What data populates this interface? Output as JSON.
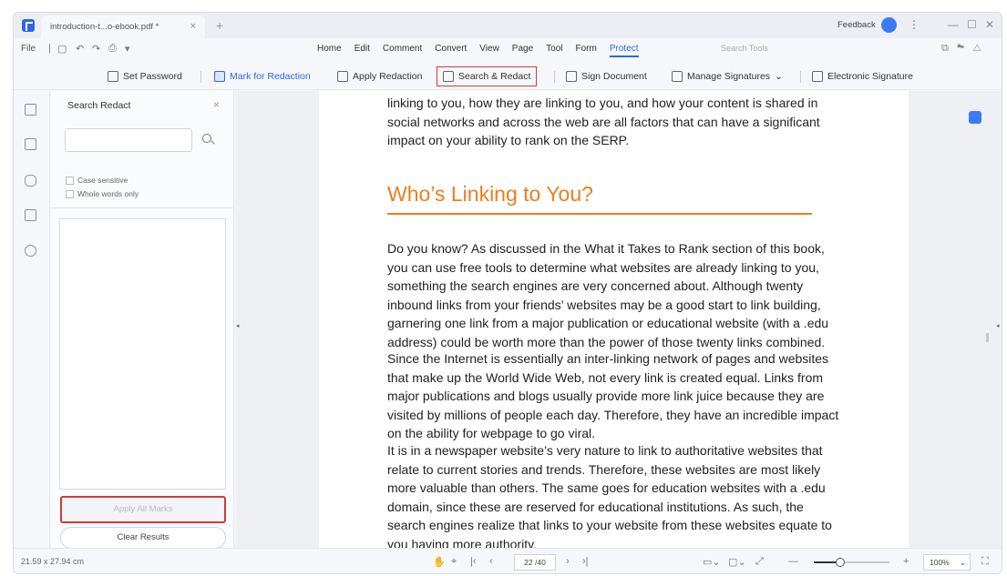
{
  "window": {
    "tab_title": "introduction-t...o-ebook.pdf *",
    "tab_close": "×",
    "tab_add": "+",
    "feedback": "Feedback",
    "avatar_letter": "",
    "kebab": "⋮",
    "btn_minimize": "—",
    "btn_maximize": "☐",
    "btn_close": "✕"
  },
  "menubar": {
    "file": "File",
    "tabs": [
      "Home",
      "Edit",
      "Comment",
      "Convert",
      "View",
      "Page",
      "Tool",
      "Form",
      "Protect"
    ],
    "active_tab": "Protect",
    "search_tools": "Search Tools"
  },
  "toolbar": {
    "set_password": "Set Password",
    "mark_for_redaction": "Mark for Redaction",
    "apply_redaction": "Apply Redaction",
    "search_redact": "Search & Redact",
    "sign_document": "Sign Document",
    "manage_signatures": "Manage Signatures",
    "electronic_signature": "Electronic Signature"
  },
  "panel": {
    "title": "Search  Redact",
    "close": "×",
    "search_value": "",
    "case_sensitive": "Case sensitive",
    "whole_words": "Whole words only",
    "apply_all_marks": "Apply All Marks",
    "clear_results": "Clear Results"
  },
  "document": {
    "para_top": "linking to you, how they are linking to you, and how your content is shared in social networks and across the web are all factors that can have a significant impact on your ability to rank on the SERP.",
    "heading": "Who’s Linking to You?",
    "para1": "Do you know? As discussed in the What it Takes to Rank section of this book, you can use free tools to determine what websites are already linking to you, something the search engines are very concerned about. Although twenty inbound links from your friends’ websites may be a good start to link building, garnering one link from a major publication or educational website (with a .edu address) could be worth more than the power of those twenty links combined.",
    "para2": "Since the Internet is essentially an inter-linking network of pages and websites that make up the World Wide Web, not every link is created equal. Links from major publications and blogs usually provide more link juice because they are visited by millions of people each day. Therefore, they have an incredible impact on the ability for webpage to go viral.",
    "para3": "It is in a newspaper website’s very nature to link to authoritative websites that relate to current stories and trends. Therefore, these websites are most likely more valuable than others. The same goes for education websites with a .edu domain, since these are reserved for educational institutions. As such, the search engines realize that links to your website from these websites equate to you having more authority."
  },
  "statusbar": {
    "dimensions": "21.59 x 27.94 cm",
    "page": "22 /40",
    "zoom": "100%",
    "zoom_level": 0.35
  },
  "colors": {
    "accent": "#2a67e8",
    "heading": "#ee7d1f",
    "highlight_box": "#d23a3a"
  }
}
